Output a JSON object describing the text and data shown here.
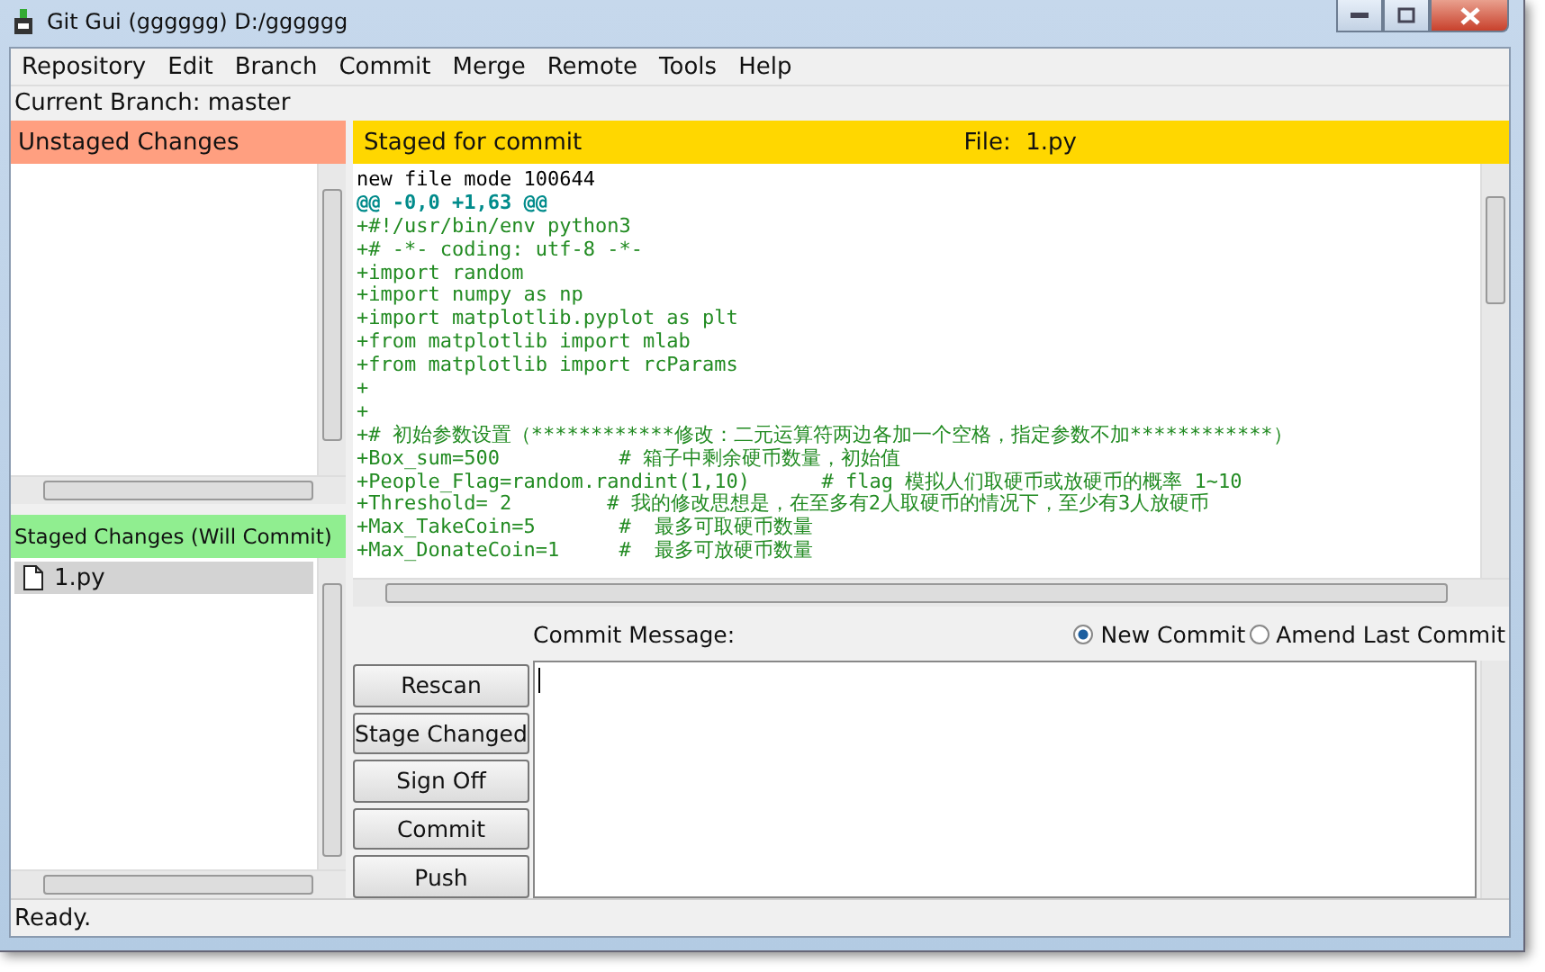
{
  "window": {
    "title": "Git Gui (gggggg) D:/gggggg"
  },
  "menu": [
    "Repository",
    "Edit",
    "Branch",
    "Commit",
    "Merge",
    "Remote",
    "Tools",
    "Help"
  ],
  "current_branch": "Current Branch: master",
  "unstaged": {
    "title": "Unstaged Changes"
  },
  "staged": {
    "title": "Staged Changes (Will Commit)",
    "files": [
      {
        "name": "1.py",
        "selected": true
      }
    ]
  },
  "diff": {
    "title": "Staged for commit",
    "file_label": "File:",
    "file": "1.py",
    "lines": [
      {
        "kind": "meta",
        "text": "new file mode 100644"
      },
      {
        "kind": "hunk",
        "text": "@@ -0,0 +1,63 @@"
      },
      {
        "kind": "add",
        "text": "+#!/usr/bin/env python3"
      },
      {
        "kind": "add",
        "text": "+# -*- coding: utf-8 -*-"
      },
      {
        "kind": "add",
        "text": "+import random"
      },
      {
        "kind": "add",
        "text": "+import numpy as np"
      },
      {
        "kind": "add",
        "text": "+import matplotlib.pyplot as plt"
      },
      {
        "kind": "add",
        "text": "+from matplotlib import mlab"
      },
      {
        "kind": "add",
        "text": "+from matplotlib import rcParams"
      },
      {
        "kind": "add",
        "text": "+"
      },
      {
        "kind": "add",
        "text": "+"
      },
      {
        "kind": "add",
        "text": "+# 初始参数设置（************修改：二元运算符两边各加一个空格，指定参数不加************）"
      },
      {
        "kind": "add",
        "text": "+Box_sum=500          # 箱子中剩余硬币数量，初始值"
      },
      {
        "kind": "add",
        "text": "+People_Flag=random.randint(1,10)      # flag 模拟人们取硬币或放硬币的概率 1~10"
      },
      {
        "kind": "add",
        "text": "+Threshold= 2        # 我的修改思想是，在至多有2人取硬币的情况下，至少有3人放硬币"
      },
      {
        "kind": "add",
        "text": "+Max_TakeCoin=5       #  最多可取硬币数量"
      },
      {
        "kind": "add",
        "text": "+Max_DonateCoin=1     #  最多可放硬币数量"
      }
    ]
  },
  "commit": {
    "label": "Commit Message:",
    "options": [
      {
        "label": "New Commit",
        "selected": true
      },
      {
        "label": "Amend Last Commit",
        "selected": false
      }
    ],
    "buttons": [
      "Rescan",
      "Stage Changed",
      "Sign Off",
      "Commit",
      "Push"
    ]
  },
  "status_bar": "Ready."
}
